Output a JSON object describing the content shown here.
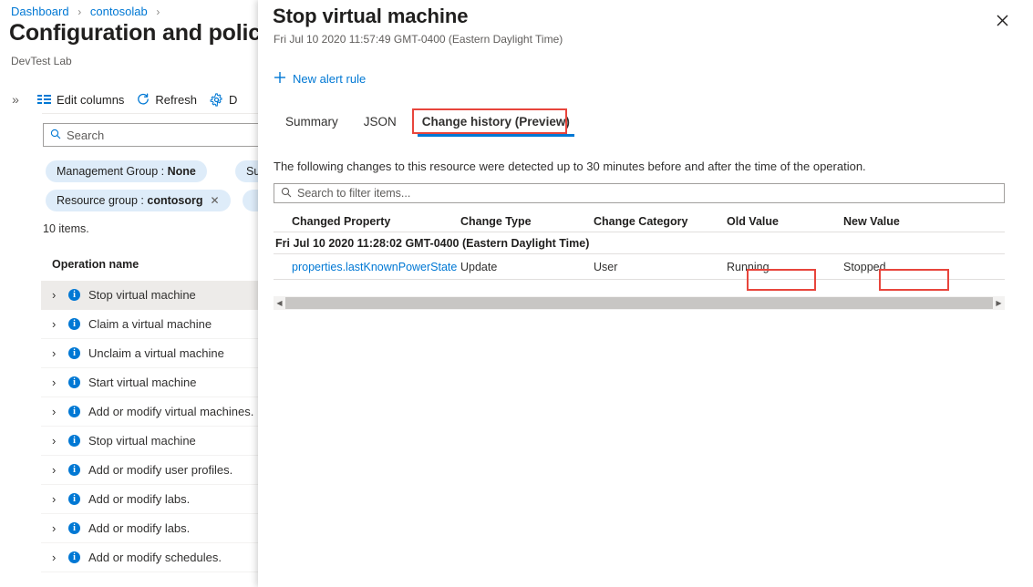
{
  "background_page": {
    "breadcrumb": {
      "items": [
        "Dashboard",
        "contosolab"
      ],
      "separator": "›"
    },
    "title": "Configuration and policies",
    "subtitle": "DevTest Lab",
    "toolbar": {
      "expand_label": "»",
      "edit_columns": "Edit columns",
      "refresh": "Refresh",
      "truncated_item": "D"
    },
    "search": {
      "placeholder": "Search"
    },
    "filters": [
      {
        "label": "Management Group :",
        "value": "None",
        "dismissable": false
      },
      {
        "label": "Su",
        "value": "",
        "dismissable": false
      },
      {
        "label": "Resource group :",
        "value": "contosorg",
        "dismissable": true
      }
    ],
    "item_count": "10 items.",
    "list_header": "Operation name",
    "operations": [
      {
        "label": "Stop virtual machine",
        "selected": true
      },
      {
        "label": "Claim a virtual machine",
        "selected": false
      },
      {
        "label": "Unclaim a virtual machine",
        "selected": false
      },
      {
        "label": "Start virtual machine",
        "selected": false
      },
      {
        "label": "Add or modify virtual machines.",
        "selected": false
      },
      {
        "label": "Stop virtual machine",
        "selected": false
      },
      {
        "label": "Add or modify user profiles.",
        "selected": false
      },
      {
        "label": "Add or modify labs.",
        "selected": false
      },
      {
        "label": "Add or modify labs.",
        "selected": false
      },
      {
        "label": "Add or modify schedules.",
        "selected": false
      }
    ]
  },
  "panel": {
    "title": "Stop virtual machine",
    "subtitle": "Fri Jul 10 2020 11:57:49 GMT-0400 (Eastern Daylight Time)",
    "close_icon": "close-icon",
    "command": {
      "icon": "plus-icon",
      "label": "New alert rule"
    },
    "tabs": [
      {
        "label": "Summary",
        "active": false
      },
      {
        "label": "JSON",
        "active": false
      },
      {
        "label": "Change history (Preview)",
        "active": true
      }
    ],
    "description": "The following changes to this resource were detected up to 30 minutes before and after the time of the operation.",
    "filter_search": {
      "placeholder": "Search to filter items..."
    },
    "table": {
      "columns": [
        "Changed Property",
        "Change Type",
        "Change Category",
        "Old Value",
        "New Value"
      ],
      "groups": [
        {
          "label": "Fri Jul 10 2020 11:28:02 GMT-0400 (Eastern Daylight Time)",
          "rows": [
            {
              "changed_property": "properties.lastKnownPowerState",
              "change_type": "Update",
              "change_category": "User",
              "old_value": "Running",
              "new_value": "Stopped"
            }
          ]
        }
      ]
    },
    "scrollbar": {
      "left_arrow": "◀",
      "right_arrow": "▶"
    }
  },
  "annotations": {
    "color": "#e8453c",
    "boxes": [
      "change-history-tab",
      "old-value-cell",
      "new-value-cell"
    ]
  },
  "colors": {
    "accent": "#0078d4",
    "pill_bg": "#deecf9",
    "selected_row": "#edebe9",
    "annotation_red": "#e8453c"
  }
}
